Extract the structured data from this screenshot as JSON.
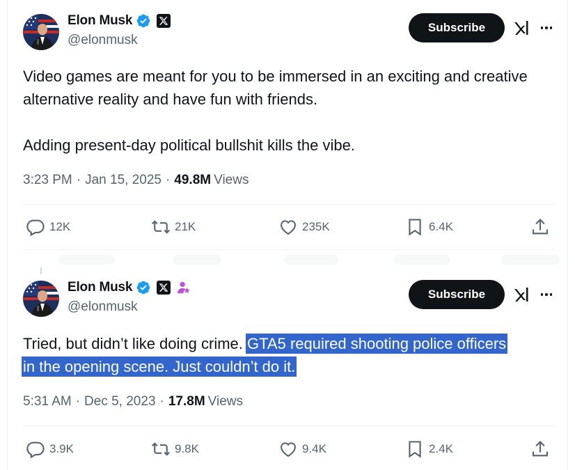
{
  "colors": {
    "text": "#0f1419",
    "secondary": "#536471",
    "verified_blue": "#1d9bf0",
    "highlight": "#3366cc",
    "role_purple": "#c050e0"
  },
  "tweets": [
    {
      "author": "Elon Musk",
      "handle": "@elonmusk",
      "subscribe_label": "Subscribe",
      "text_pre": "Video games are meant for you to be immersed in an exciting and creative alternative reality and have fun with friends.",
      "text_para2": "Adding present-day political bullshit kills the vibe.",
      "time": "3:23 PM",
      "date": "Jan 15, 2025",
      "views_count": "49.8M",
      "views_label": "Views",
      "replies": "12K",
      "reposts": "21K",
      "likes": "235K",
      "bookmarks": "6.4K"
    },
    {
      "author": "Elon Musk",
      "handle": "@elonmusk",
      "subscribe_label": "Subscribe",
      "text_pre": "Tried, but didn’t like doing crime. ",
      "text_highlight_1": "GTA5 required shooting police officers ",
      "text_highlight_2": "in the opening scene. Just couldn’t do it.",
      "time": "5:31 AM",
      "date": "Dec 5, 2023",
      "views_count": "17.8M",
      "views_label": "Views",
      "replies": "3.9K",
      "reposts": "9.8K",
      "likes": "9.4K",
      "bookmarks": "2.4K"
    }
  ],
  "separator": "·",
  "icons": [
    "verified-badge-icon",
    "x-logo-icon",
    "grok-icon",
    "more-icon",
    "reply-icon",
    "repost-icon",
    "like-icon",
    "bookmark-icon",
    "share-icon",
    "role-badge-icon"
  ]
}
